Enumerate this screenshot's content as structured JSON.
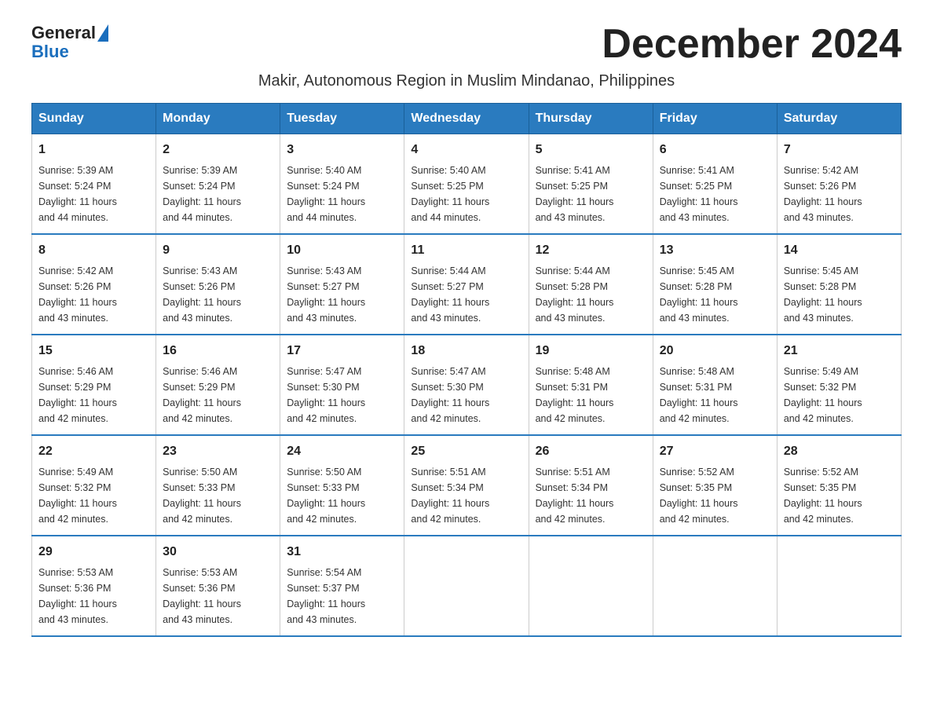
{
  "logo": {
    "text_general": "General",
    "text_blue": "Blue"
  },
  "title": "December 2024",
  "subtitle": "Makir, Autonomous Region in Muslim Mindanao, Philippines",
  "header_days": [
    "Sunday",
    "Monday",
    "Tuesday",
    "Wednesday",
    "Thursday",
    "Friday",
    "Saturday"
  ],
  "weeks": [
    [
      {
        "day": "1",
        "sunrise": "5:39 AM",
        "sunset": "5:24 PM",
        "daylight": "11 hours and 44 minutes."
      },
      {
        "day": "2",
        "sunrise": "5:39 AM",
        "sunset": "5:24 PM",
        "daylight": "11 hours and 44 minutes."
      },
      {
        "day": "3",
        "sunrise": "5:40 AM",
        "sunset": "5:24 PM",
        "daylight": "11 hours and 44 minutes."
      },
      {
        "day": "4",
        "sunrise": "5:40 AM",
        "sunset": "5:25 PM",
        "daylight": "11 hours and 44 minutes."
      },
      {
        "day": "5",
        "sunrise": "5:41 AM",
        "sunset": "5:25 PM",
        "daylight": "11 hours and 43 minutes."
      },
      {
        "day": "6",
        "sunrise": "5:41 AM",
        "sunset": "5:25 PM",
        "daylight": "11 hours and 43 minutes."
      },
      {
        "day": "7",
        "sunrise": "5:42 AM",
        "sunset": "5:26 PM",
        "daylight": "11 hours and 43 minutes."
      }
    ],
    [
      {
        "day": "8",
        "sunrise": "5:42 AM",
        "sunset": "5:26 PM",
        "daylight": "11 hours and 43 minutes."
      },
      {
        "day": "9",
        "sunrise": "5:43 AM",
        "sunset": "5:26 PM",
        "daylight": "11 hours and 43 minutes."
      },
      {
        "day": "10",
        "sunrise": "5:43 AM",
        "sunset": "5:27 PM",
        "daylight": "11 hours and 43 minutes."
      },
      {
        "day": "11",
        "sunrise": "5:44 AM",
        "sunset": "5:27 PM",
        "daylight": "11 hours and 43 minutes."
      },
      {
        "day": "12",
        "sunrise": "5:44 AM",
        "sunset": "5:28 PM",
        "daylight": "11 hours and 43 minutes."
      },
      {
        "day": "13",
        "sunrise": "5:45 AM",
        "sunset": "5:28 PM",
        "daylight": "11 hours and 43 minutes."
      },
      {
        "day": "14",
        "sunrise": "5:45 AM",
        "sunset": "5:28 PM",
        "daylight": "11 hours and 43 minutes."
      }
    ],
    [
      {
        "day": "15",
        "sunrise": "5:46 AM",
        "sunset": "5:29 PM",
        "daylight": "11 hours and 42 minutes."
      },
      {
        "day": "16",
        "sunrise": "5:46 AM",
        "sunset": "5:29 PM",
        "daylight": "11 hours and 42 minutes."
      },
      {
        "day": "17",
        "sunrise": "5:47 AM",
        "sunset": "5:30 PM",
        "daylight": "11 hours and 42 minutes."
      },
      {
        "day": "18",
        "sunrise": "5:47 AM",
        "sunset": "5:30 PM",
        "daylight": "11 hours and 42 minutes."
      },
      {
        "day": "19",
        "sunrise": "5:48 AM",
        "sunset": "5:31 PM",
        "daylight": "11 hours and 42 minutes."
      },
      {
        "day": "20",
        "sunrise": "5:48 AM",
        "sunset": "5:31 PM",
        "daylight": "11 hours and 42 minutes."
      },
      {
        "day": "21",
        "sunrise": "5:49 AM",
        "sunset": "5:32 PM",
        "daylight": "11 hours and 42 minutes."
      }
    ],
    [
      {
        "day": "22",
        "sunrise": "5:49 AM",
        "sunset": "5:32 PM",
        "daylight": "11 hours and 42 minutes."
      },
      {
        "day": "23",
        "sunrise": "5:50 AM",
        "sunset": "5:33 PM",
        "daylight": "11 hours and 42 minutes."
      },
      {
        "day": "24",
        "sunrise": "5:50 AM",
        "sunset": "5:33 PM",
        "daylight": "11 hours and 42 minutes."
      },
      {
        "day": "25",
        "sunrise": "5:51 AM",
        "sunset": "5:34 PM",
        "daylight": "11 hours and 42 minutes."
      },
      {
        "day": "26",
        "sunrise": "5:51 AM",
        "sunset": "5:34 PM",
        "daylight": "11 hours and 42 minutes."
      },
      {
        "day": "27",
        "sunrise": "5:52 AM",
        "sunset": "5:35 PM",
        "daylight": "11 hours and 42 minutes."
      },
      {
        "day": "28",
        "sunrise": "5:52 AM",
        "sunset": "5:35 PM",
        "daylight": "11 hours and 42 minutes."
      }
    ],
    [
      {
        "day": "29",
        "sunrise": "5:53 AM",
        "sunset": "5:36 PM",
        "daylight": "11 hours and 43 minutes."
      },
      {
        "day": "30",
        "sunrise": "5:53 AM",
        "sunset": "5:36 PM",
        "daylight": "11 hours and 43 minutes."
      },
      {
        "day": "31",
        "sunrise": "5:54 AM",
        "sunset": "5:37 PM",
        "daylight": "11 hours and 43 minutes."
      },
      null,
      null,
      null,
      null
    ]
  ],
  "labels": {
    "sunrise": "Sunrise: ",
    "sunset": "Sunset: ",
    "daylight": "Daylight: "
  }
}
